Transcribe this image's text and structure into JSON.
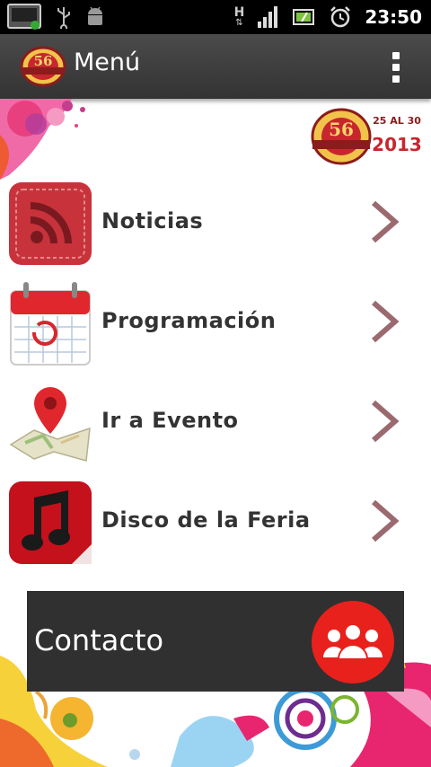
{
  "status_bar": {
    "time": "23:50",
    "network_label": "H",
    "icons": [
      "screenshot-notification-icon",
      "usb-icon",
      "android-debug-icon",
      "hspa-network-icon",
      "signal-icon",
      "battery-icon",
      "alarm-icon"
    ]
  },
  "action_bar": {
    "title": "Menú",
    "logo_number": "56"
  },
  "event_logo": {
    "number": "56",
    "dates": "25 AL 30",
    "year": "2013"
  },
  "menu": {
    "items": [
      {
        "label": "Noticias",
        "icon": "rss-icon"
      },
      {
        "label": "Programación",
        "icon": "calendar-icon"
      },
      {
        "label": "Ir a Evento",
        "icon": "map-pin-icon"
      },
      {
        "label": "Disco de la Feria",
        "icon": "music-note-icon"
      }
    ]
  },
  "contact": {
    "label": "Contacto",
    "icon": "group-icon"
  },
  "colors": {
    "action_bar": "#3d3d3d",
    "chevron": "#9b6a6f",
    "contact_bg": "#303030",
    "contact_icon": "#e8211c",
    "rss_red": "#c8333b"
  }
}
